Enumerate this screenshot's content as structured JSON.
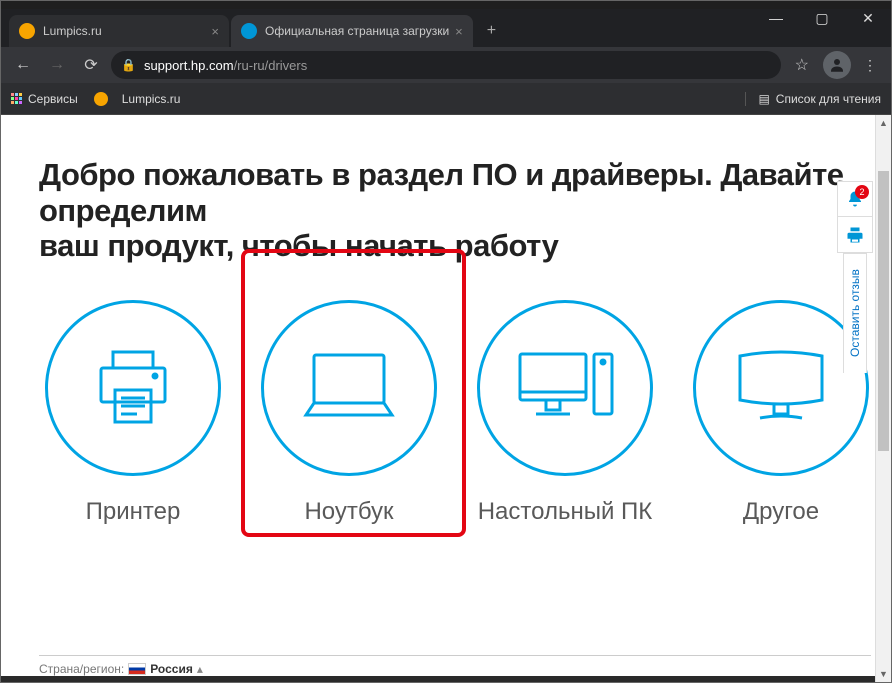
{
  "window_controls": {
    "minimize": "—",
    "maximize": "▢",
    "close": "✕"
  },
  "tabs": [
    {
      "title": "Lumpics.ru",
      "favicon": "lumpics",
      "active": false
    },
    {
      "title": "Официальная страница загрузки",
      "favicon": "hp",
      "active": true
    }
  ],
  "urlbar": {
    "back": "←",
    "forward": "→",
    "reload": "⟳",
    "domain": "support.hp.com",
    "path": "/ru-ru/drivers"
  },
  "bookmarks": {
    "services": "Сервисы",
    "lumpics": "Lumpics.ru",
    "reading_list": "Список для чтения"
  },
  "page": {
    "heading_line1": "Добро пожаловать в раздел ПО и драйверы. Давайте определим",
    "heading_line2": "ваш продукт, чтобы начать работу",
    "categories": [
      {
        "name": "printer",
        "label": "Принтер"
      },
      {
        "name": "laptop",
        "label": "Ноутбук"
      },
      {
        "name": "desktop",
        "label": "Настольный ПК"
      },
      {
        "name": "other",
        "label": "Другое"
      }
    ],
    "side": {
      "notifications_badge": "2",
      "feedback_label": "Оставить отзыв"
    },
    "footer": {
      "region_label": "Страна/регион:",
      "region_value": "Россия"
    }
  }
}
